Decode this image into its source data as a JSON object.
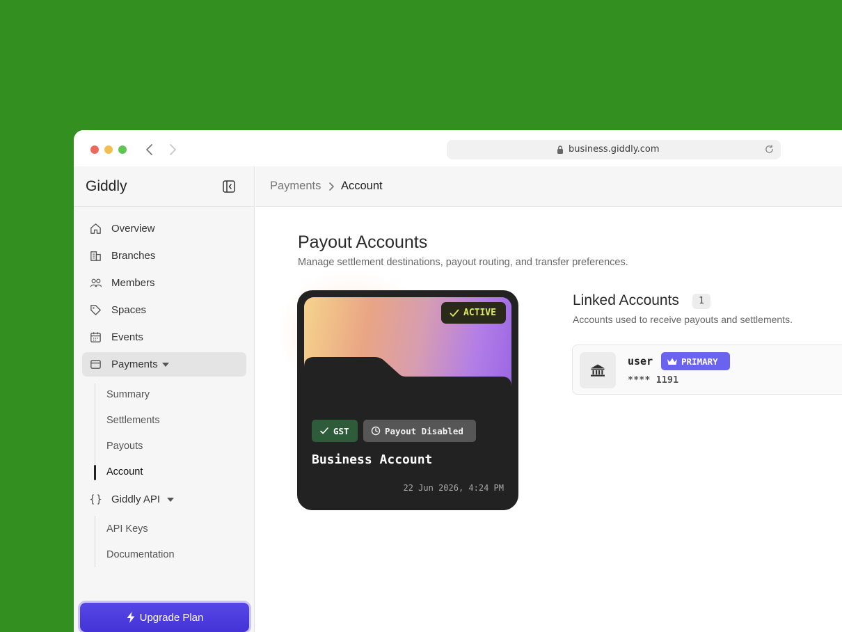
{
  "browser": {
    "url": "business.giddly.com"
  },
  "sidebar": {
    "brand": "Giddly",
    "items": [
      {
        "label": "Overview",
        "icon": "home-icon"
      },
      {
        "label": "Branches",
        "icon": "building-icon"
      },
      {
        "label": "Members",
        "icon": "users-icon"
      },
      {
        "label": "Spaces",
        "icon": "tag-icon"
      },
      {
        "label": "Events",
        "icon": "calendar-icon"
      },
      {
        "label": "Payments",
        "icon": "wallet-icon",
        "expanded": true
      },
      {
        "label": "Giddly API",
        "icon": "braces-icon",
        "expanded": true
      }
    ],
    "payments_sub": [
      "Summary",
      "Settlements",
      "Payouts",
      "Account"
    ],
    "api_sub": [
      "API Keys",
      "Documentation"
    ],
    "upgrade_label": "Upgrade Plan"
  },
  "breadcrumb": {
    "parent": "Payments",
    "current": "Account"
  },
  "main": {
    "title": "Payout Accounts",
    "subtitle": "Manage settlement destinations, payout routing, and transfer preferences."
  },
  "card": {
    "status": "ACTIVE",
    "tax_badge": "GST",
    "payout_badge": "Payout Disabled",
    "name": "Business Account",
    "date": "22 Jun 2026, 4:24 PM"
  },
  "linked": {
    "title": "Linked Accounts",
    "count": "1",
    "subtitle": "Accounts used to receive payouts and settlements.",
    "accounts": [
      {
        "name": "user",
        "badge": "PRIMARY",
        "masked": "**** 1191"
      }
    ]
  },
  "colors": {
    "accent": "#5647e6",
    "primary_badge": "#6a63ef",
    "active_badge_text": "#d9ec5c",
    "gst_badge": "#2e5c3a"
  }
}
